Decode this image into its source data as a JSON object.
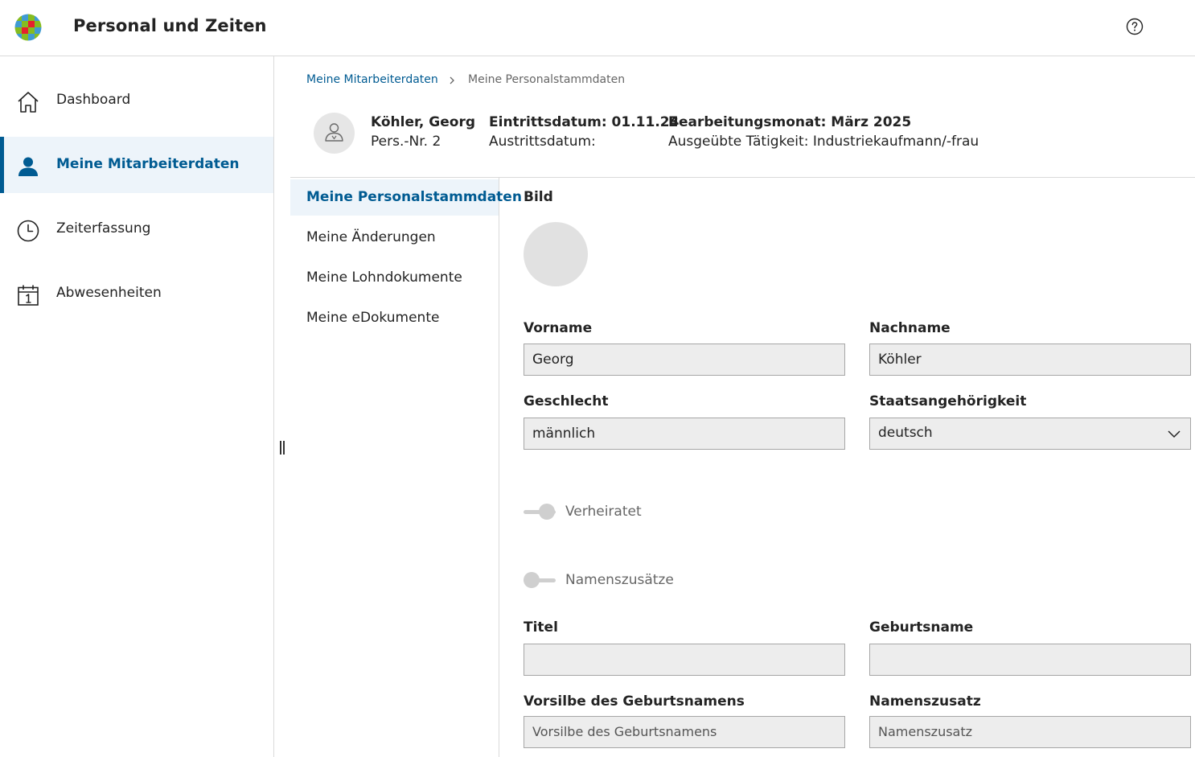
{
  "header": {
    "title": "Personal und Zeiten",
    "help_icon": "help-circle-icon"
  },
  "sidebar": {
    "items": [
      {
        "label": "Dashboard",
        "icon": "home-icon",
        "active": false
      },
      {
        "label": "Meine Mitarbeiterdaten",
        "icon": "person-icon",
        "active": true
      },
      {
        "label": "Zeiterfassung",
        "icon": "clock-icon",
        "active": false
      },
      {
        "label": "Abwesenheiten",
        "icon": "calendar-icon",
        "active": false
      }
    ]
  },
  "breadcrumb": {
    "parent": "Meine Mitarbeiterdaten",
    "current": "Meine Personalstammdaten"
  },
  "employee": {
    "name": "Köhler, Georg",
    "pers_nr": "Pers.-Nr. 2",
    "eintritt": "Eintrittsdatum: 01.11.24",
    "austritt": "Austrittsdatum:",
    "bearbeitungsmonat": "Bearbeitungsmonat: März 2025",
    "taetigkeit": "Ausgeübte Tätigkeit: Industriekaufmann/-frau"
  },
  "subnav": {
    "items": [
      {
        "label": "Meine Personalstammdaten",
        "active": true
      },
      {
        "label": "Meine Änderungen",
        "active": false
      },
      {
        "label": "Meine Lohndokumente",
        "active": false
      },
      {
        "label": "Meine eDokumente",
        "active": false
      }
    ]
  },
  "form": {
    "bild_label": "Bild",
    "vorname": {
      "label": "Vorname",
      "value": "Georg"
    },
    "nachname": {
      "label": "Nachname",
      "value": "Köhler"
    },
    "geschlecht": {
      "label": "Geschlecht",
      "value": "männlich"
    },
    "staatsangehoerigkeit": {
      "label": "Staatsangehörigkeit",
      "value": "deutsch"
    },
    "verheiratet": {
      "label": "Verheiratet",
      "checked": true
    },
    "namenszusaetze": {
      "label": "Namenszusätze",
      "checked": false
    },
    "titel": {
      "label": "Titel",
      "value": ""
    },
    "geburtsname": {
      "label": "Geburtsname",
      "value": ""
    },
    "vorsilbe": {
      "label": "Vorsilbe des Geburtsnamens",
      "placeholder": "Vorsilbe des Geburtsnamens"
    },
    "namenszusatz": {
      "label": "Namenszusatz",
      "placeholder": "Namenszusatz"
    }
  },
  "colors": {
    "accent": "#005b92",
    "active_bg": "#edf4fa",
    "field_bg": "#ededed"
  }
}
